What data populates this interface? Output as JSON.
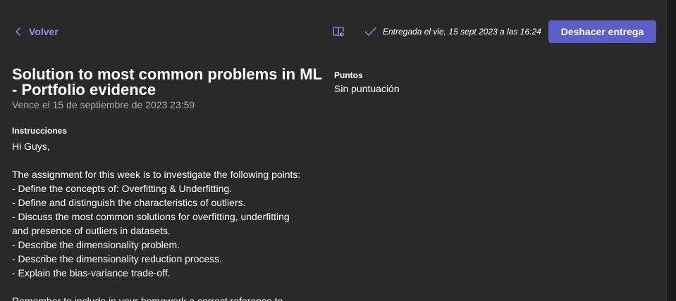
{
  "header": {
    "back_label": "Volver",
    "submitted_status": "Entregada el vie, 15 sept 2023 a las 16:24",
    "undo_button_label": "Deshacer entrega",
    "immersive_reader_icon": "immersive-reader-icon",
    "accent_color": "#5b5fc7",
    "link_color": "#8f92ed"
  },
  "assignment": {
    "title": "Solution to most common problems in ML - Portfolio evidence",
    "due_text": "Vence el 15 de septiembre de 2023 23:59",
    "instructions_label": "Instrucciones",
    "instructions_lines": [
      "Hi Guys,",
      "",
      "The assignment for this week is to investigate the following points:",
      "- Define the concepts of: Overfitting & Underfitting.",
      "- Define and distinguish the characteristics of outliers.",
      "- Discuss the most common solutions for overfitting, underfitting",
      "and presence of outliers in datasets.",
      "- Describe the dimensionality problem.",
      "- Describe the dimensionality reduction process.",
      "- Explain the bias-variance trade-off.",
      "",
      "Remember to include in your homework a correct reference to"
    ]
  },
  "points": {
    "label": "Puntos",
    "value": "Sin puntuación"
  }
}
